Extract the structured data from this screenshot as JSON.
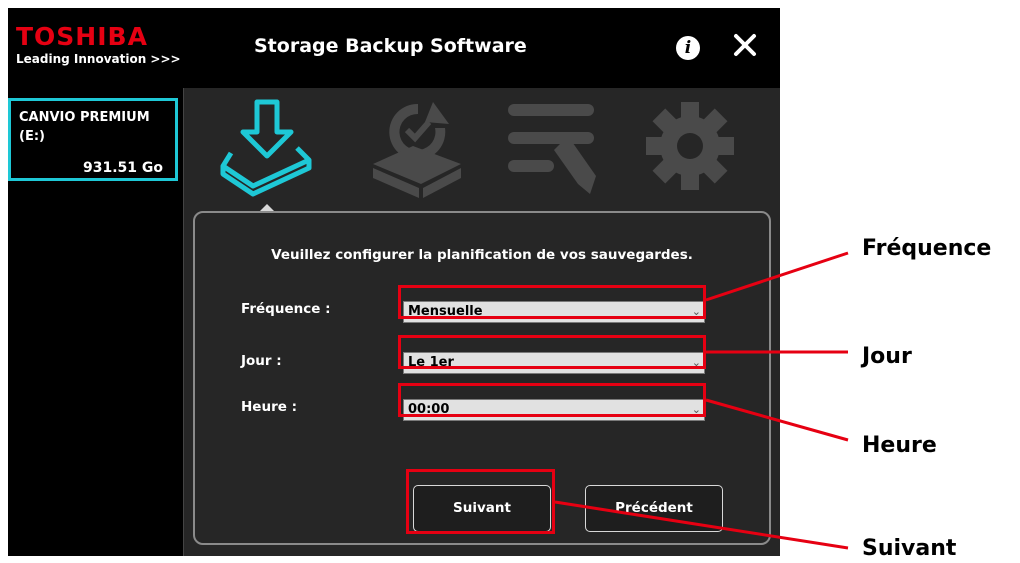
{
  "header": {
    "brand": "TOSHIBA",
    "tagline": "Leading Innovation >>>",
    "app_title": "Storage Backup Software"
  },
  "sidebar": {
    "drive_name": "CANVIO PREMIUM",
    "drive_letter": "(E:)",
    "drive_size": "931.51 Go"
  },
  "toolbar": {
    "icons": [
      "backup-download-icon",
      "restore-icon",
      "edit-settings-icon",
      "gear-icon"
    ],
    "active_color": "#1ec8d6",
    "inactive_color": "#4a4a4a"
  },
  "form": {
    "instruction": "Veuillez configurer la planification de vos sauvegardes.",
    "frequency_label": "Fréquence :",
    "frequency_value": "Mensuelle",
    "day_label": "Jour :",
    "day_value": "Le 1er",
    "time_label": "Heure :",
    "time_value": "00:00"
  },
  "buttons": {
    "next": "Suivant",
    "previous": "Précédent"
  },
  "callouts": {
    "frequency": "Fréquence",
    "day": "Jour",
    "time": "Heure",
    "next": "Suivant"
  },
  "colors": {
    "highlight": "#e60012",
    "accent": "#1ec8d6"
  }
}
